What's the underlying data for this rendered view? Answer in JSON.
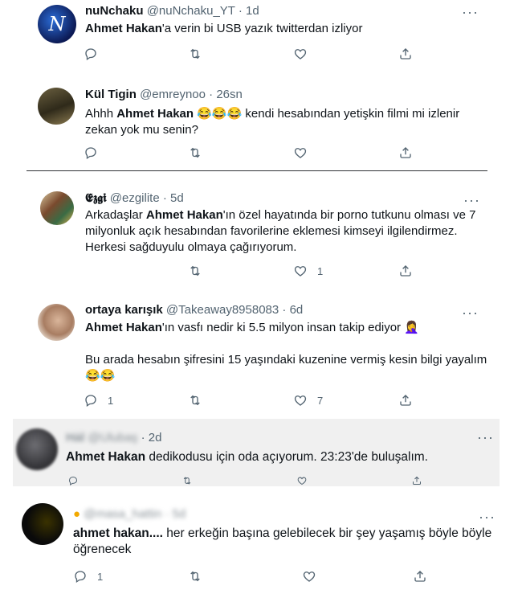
{
  "tweets": [
    {
      "name": "nuNchaku",
      "handle": "@nuNchaku_YT",
      "time": "1d",
      "text_bold": "Ahmet Hakan",
      "text_rest": "'a verin bi USB yazık twitterdan izliyor",
      "text_line2": "",
      "likes": "",
      "replies": ""
    },
    {
      "name": "Kül Tigin",
      "handle": "@emreynoo",
      "time": "26sn",
      "text_pre": "Ahhh ",
      "text_bold": "Ahmet Hakan",
      "emojis": "😂😂😂",
      "text_rest": " kendi hesabından yetişkin filmi mi izlenir",
      "text_line2": "zekan yok mu senin?"
    },
    {
      "name": "𝕰𝖟𝖌𝖎",
      "handle": "@ezgilite",
      "time": "5d",
      "text_pre": "Arkadaşlar ",
      "text_bold": "Ahmet Hakan",
      "text_rest": "'ın özel hayatında bir porno tutkunu olması ve 7",
      "text_line2": "milyonluk açık hesabından favorilerine eklemesi kimseyi ilgilendirmez.",
      "text_line3": "Herkesi sağduyulu olmaya çağırıyorum.",
      "likes": "1"
    },
    {
      "name": "ortaya karışık",
      "handle": "@Takeaway8958083",
      "time": "6d",
      "text_bold": "Ahmet Hakan",
      "text_rest": "'ın vasfı nedir ki 5.5 milyon insan takip ediyor",
      "emoji_end": "🤦‍♀️",
      "text_line2": "Bu arada hesabın şifresini 15 yaşındaki kuzenine vermiş kesin bilgi yayalım",
      "emojis_line3": "😂😂",
      "replies": "1",
      "likes": "7"
    },
    {
      "name": "Hȧl",
      "handle": "@Ulubaş",
      "time": "2d",
      "text_bold": "Ahmet Hakan",
      "text_rest": " dedikodusu için oda açıyorum. 23:23'de buluşalım."
    },
    {
      "name": "",
      "handle": "@masa_hattin",
      "time": "5d",
      "text_bold": "ahmet hakan....",
      "text_rest": " her erkeğin başına gelebilecek bir şey yaşamış böyle böyle",
      "text_line2": "öğrenecek",
      "replies": "1"
    }
  ],
  "icons": [
    "reply-icon",
    "retweet-icon",
    "like-icon",
    "share-icon",
    "more-icon"
  ],
  "colors": {
    "text": "#0f1419",
    "muted": "#536471",
    "panel": "#f0f0f0"
  }
}
